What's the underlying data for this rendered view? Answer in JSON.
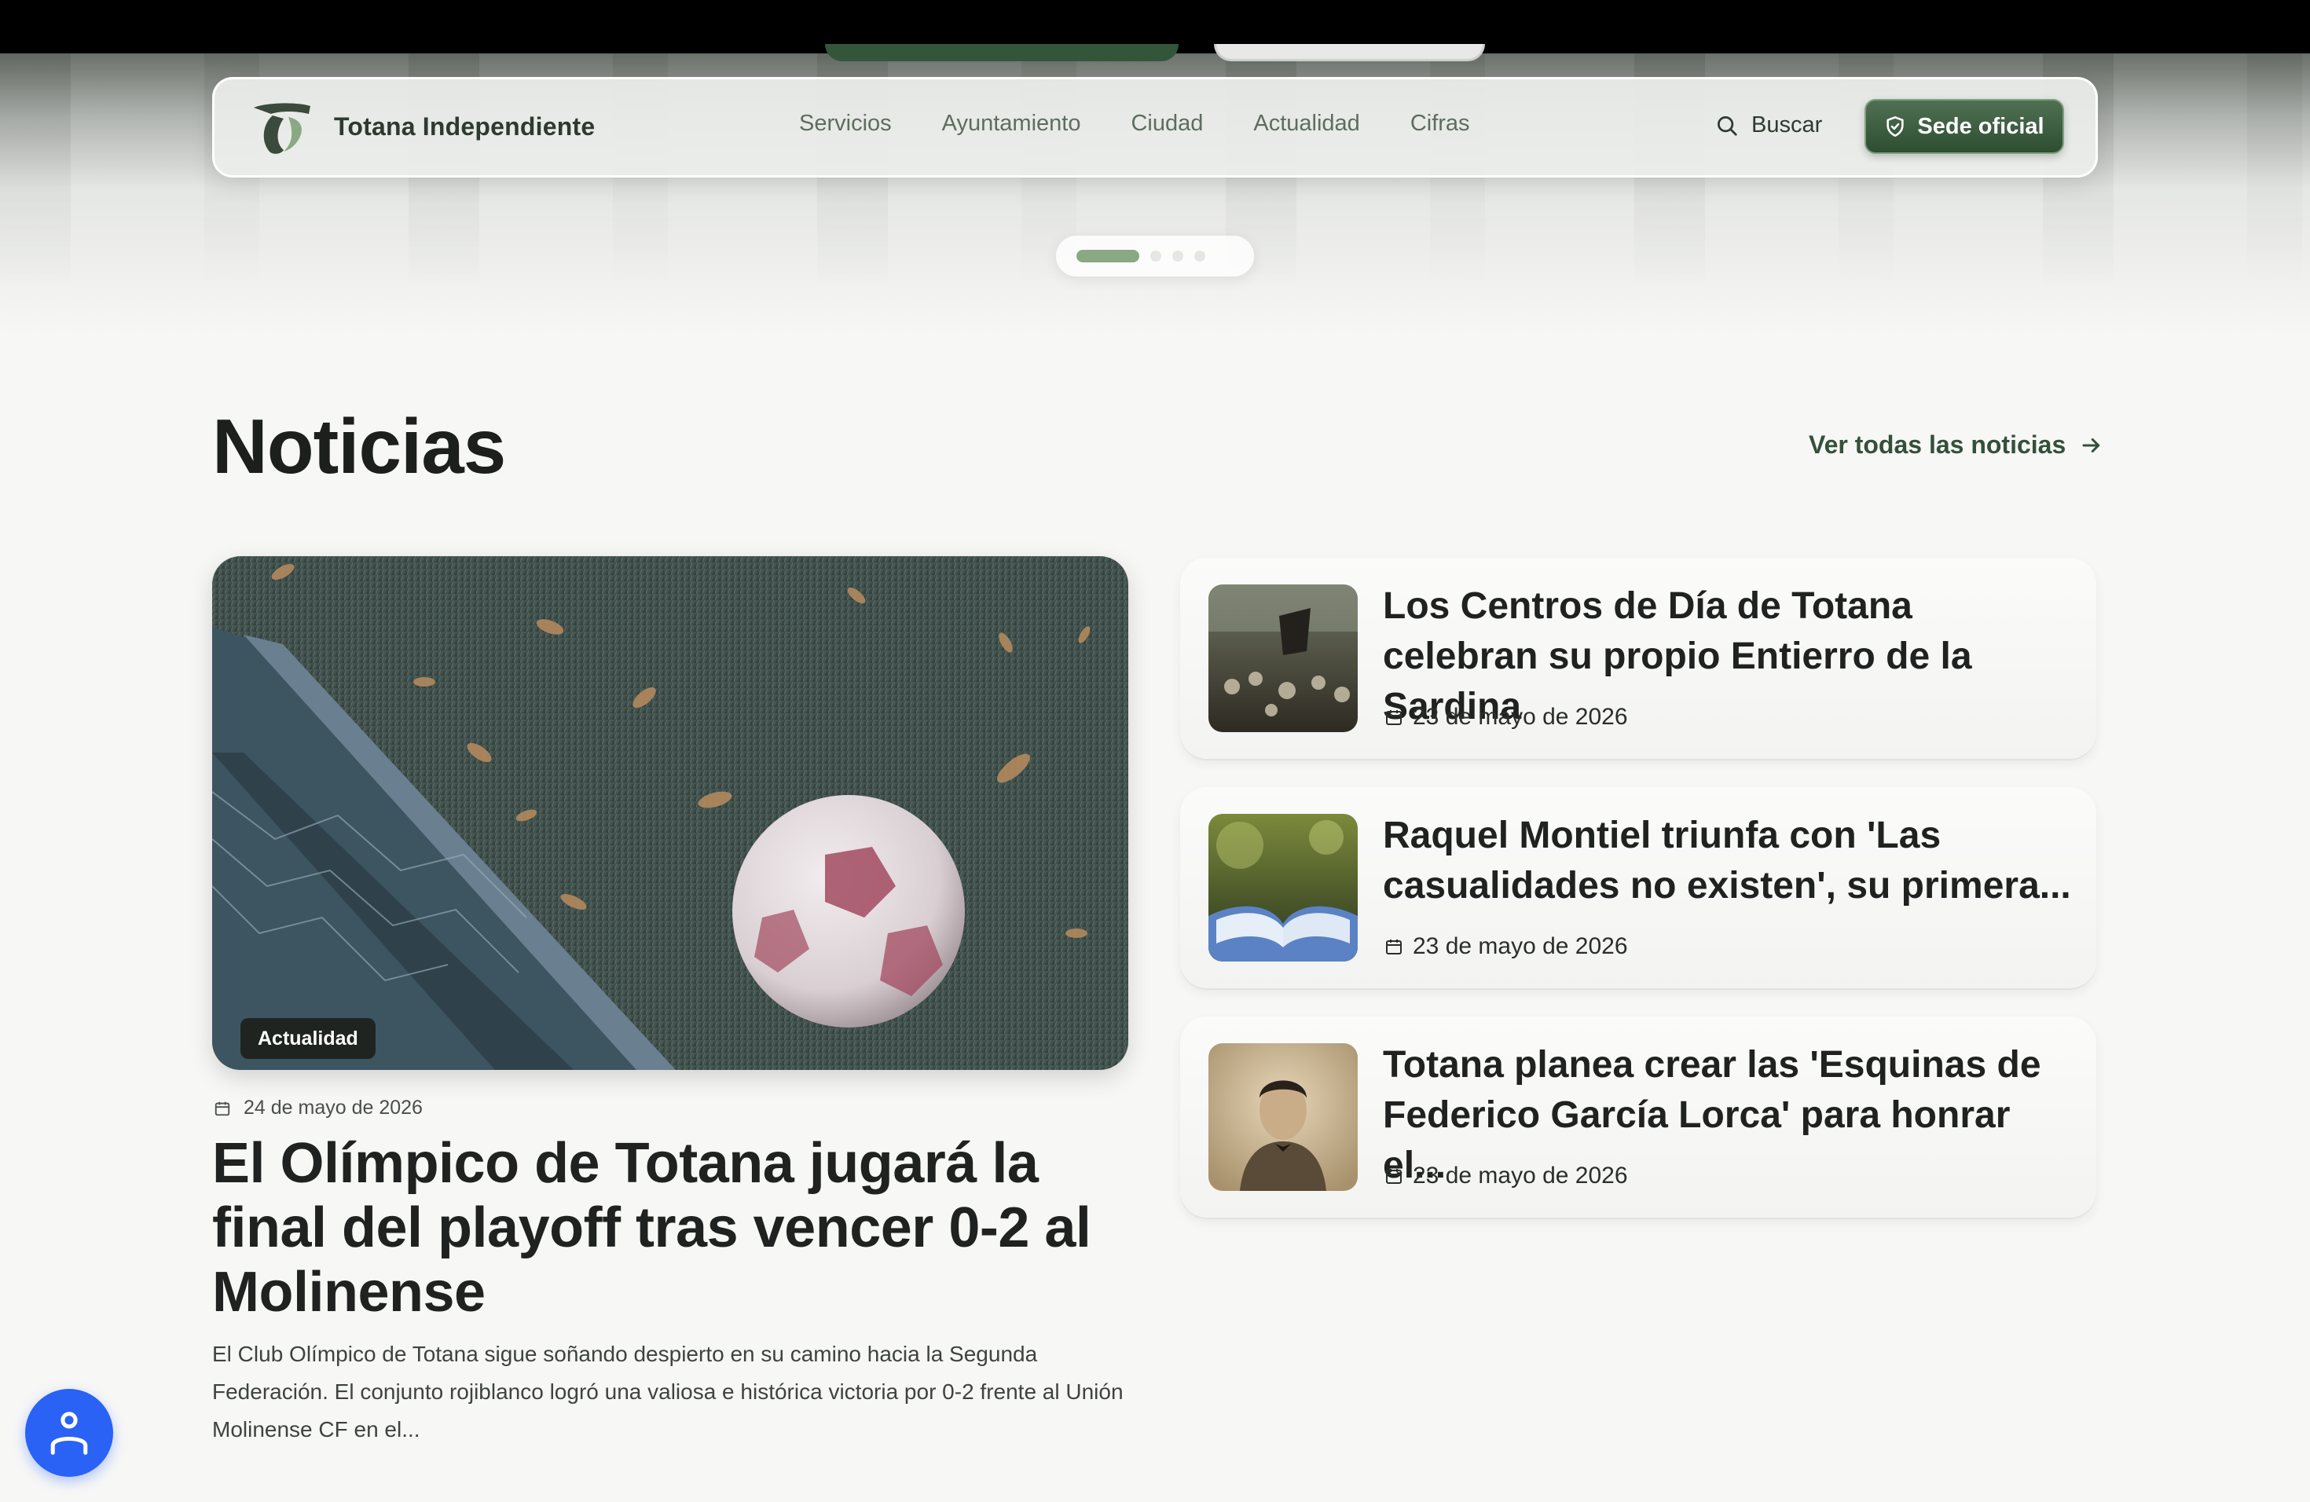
{
  "site": {
    "brand_name": "Totana Independiente"
  },
  "nav": {
    "items": [
      {
        "label": "Servicios"
      },
      {
        "label": "Ayuntamiento"
      },
      {
        "label": "Ciudad"
      },
      {
        "label": "Actualidad"
      },
      {
        "label": "Cifras"
      }
    ],
    "search_label": "Buscar",
    "cta_label": "Sede oficial"
  },
  "carousel": {
    "slides": 4,
    "active_index": 0
  },
  "news": {
    "section_title": "Noticias",
    "see_all_label": "Ver todas las noticias",
    "featured": {
      "category": "Actualidad",
      "date": "24 de mayo de 2026",
      "title": "El Olímpico de Totana jugará la final del playoff tras vencer 0-2 al Molinense",
      "excerpt": "El Club Olímpico de Totana sigue soñando despierto en su camino hacia la Segunda Federación. El conjunto rojiblanco logró una valiosa e histórica victoria por 0-2 frente al Unión Molinense CF en el..."
    },
    "list": [
      {
        "title": "Los Centros de Día de Totana celebran su propio Entierro de la Sardina",
        "date": "23 de mayo de 2026"
      },
      {
        "title": "Raquel Montiel triunfa con 'Las casualidades no existen', su primera...",
        "date": "23 de mayo de 2026"
      },
      {
        "title": "Totana planea crear las 'Esquinas de Federico García Lorca' para honrar el...",
        "date": "23 de mayo de 2026"
      }
    ]
  },
  "colors": {
    "accent_green": "#2e4e32",
    "brand_text": "#2e3a30",
    "accessibility_blue": "#2962f5"
  },
  "icons": {
    "logo": "totana-logo-icon",
    "search": "search-icon",
    "cta": "shield-check-icon",
    "arrow": "arrow-right-icon",
    "date": "calendar-icon",
    "accessibility": "person-icon"
  }
}
